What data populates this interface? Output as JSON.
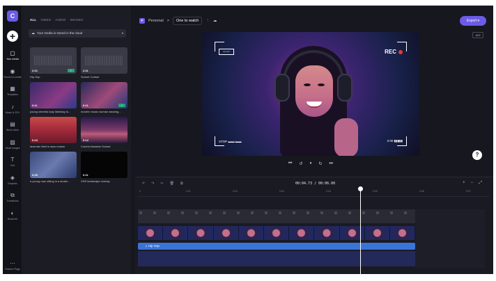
{
  "colors": {
    "accent": "#6b5ce7",
    "panel": "#1c1c25",
    "rail": "#121219",
    "audio_clip": "#3a74d8",
    "check_badge": "#27a376",
    "rec_dot": "#e23a3a"
  },
  "rail": {
    "logo": "C",
    "items": [
      {
        "label": "Your media",
        "icon": "folder-icon",
        "glyph": "▢",
        "active": true
      },
      {
        "label": "Record & create",
        "icon": "camera-icon",
        "glyph": "◉"
      },
      {
        "label": "Templates",
        "icon": "templates-icon",
        "glyph": "▦"
      },
      {
        "label": "Music & SFX",
        "icon": "music-icon",
        "glyph": "♪"
      },
      {
        "label": "Stock video",
        "icon": "film-icon",
        "glyph": "▤"
      },
      {
        "label": "Stock images",
        "icon": "image-icon",
        "glyph": "▨"
      },
      {
        "label": "Text",
        "icon": "text-icon",
        "glyph": "T"
      },
      {
        "label": "Graphics",
        "icon": "graphics-icon",
        "glyph": "◈"
      },
      {
        "label": "Transitions",
        "icon": "transitions-icon",
        "glyph": "⧉"
      },
      {
        "label": "Brand kit",
        "icon": "brand-kit-icon",
        "glyph": "◐"
      },
      {
        "label": "Feature Flags",
        "icon": "more-icon",
        "glyph": "⋯"
      }
    ]
  },
  "media": {
    "tabs": [
      "ALL",
      "VIDEO",
      "AUDIO",
      "IMAGES"
    ],
    "cloud_notice": "Your media is stored in the cloud",
    "items": [
      {
        "title": "Hip Hop",
        "duration": "2:21",
        "kind": "audio",
        "added": true
      },
      {
        "title": "Sunset Cruiser",
        "duration": "2:11",
        "kind": "audio",
        "added": false
      },
      {
        "title": "young cheerful lady listening to...",
        "duration": "0:11",
        "kind": "video",
        "added": false
      },
      {
        "title": "modern music woman wearing...",
        "duration": "0:11",
        "kind": "video",
        "added": true
      },
      {
        "title": "lavender field in slow motion",
        "duration": "0:19",
        "kind": "video",
        "added": false
      },
      {
        "title": "Colorful Alaskan Sunset",
        "duration": "0:12",
        "kind": "video",
        "added": false
      },
      {
        "title": "a young man sitting in a studio...",
        "duration": "0:09",
        "kind": "video",
        "added": false
      },
      {
        "title": "VHS landscape overlay",
        "duration": "0:11",
        "kind": "video",
        "added": false
      }
    ]
  },
  "project": {
    "workspace_initial": "P",
    "workspace": "Personal",
    "separator": ">",
    "name": "One to watch"
  },
  "export_label": "Export",
  "aspect_ratio": "16:9",
  "preview": {
    "rec": "REC",
    "battery": "▭▭▭",
    "stop": "STOP ▬▬:▬▬",
    "timecode": "2:00 ▮▮▮▮▮"
  },
  "controls": [
    "⏮",
    "↺",
    "⏸",
    "↻",
    "⏭"
  ],
  "help_label": "?",
  "timeline": {
    "tools": [
      "↶",
      "↷",
      "✂",
      "🗑",
      "⧉"
    ],
    "time": "00:04.73 / 00:06.00",
    "zoom": [
      "+",
      "−",
      "⤢"
    ],
    "ticks": [
      "0",
      "0:01",
      "0:02",
      "0:03",
      "0:04",
      "0:05",
      "0:06",
      "0:07"
    ],
    "audio_clip": "Hip Hop",
    "playhead_seconds": 4.73,
    "duration_seconds": 6.0
  }
}
